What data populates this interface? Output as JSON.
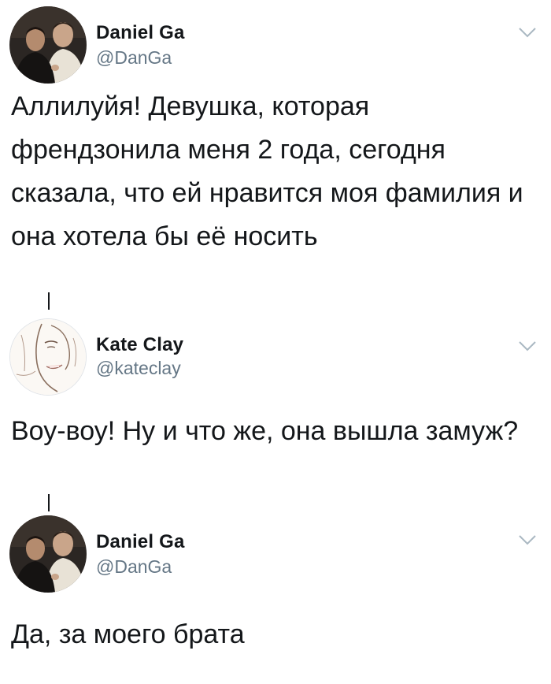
{
  "tweets": [
    {
      "name": "Daniel Ga",
      "handle": "@DanGa",
      "text": "Аллилуйя! Девушка, которая френдзонила меня 2 года, сегодня сказала, что ей нравится моя фамилия и она хотела бы её носить",
      "avatar_icon": "profile-photo"
    },
    {
      "name": "Kate Clay",
      "handle": "@kateclay",
      "text": "Воу-воу! Ну и что же, она вышла замуж?",
      "avatar_icon": "sketch-portrait"
    },
    {
      "name": "Daniel Ga",
      "handle": "@DanGa",
      "text": "Да, за моего брата",
      "avatar_icon": "profile-photo"
    }
  ],
  "icons": {
    "more": "chevron-down-icon"
  },
  "colors": {
    "text": "#14171a",
    "handle": "#657786",
    "chevron": "#aab8c2"
  }
}
